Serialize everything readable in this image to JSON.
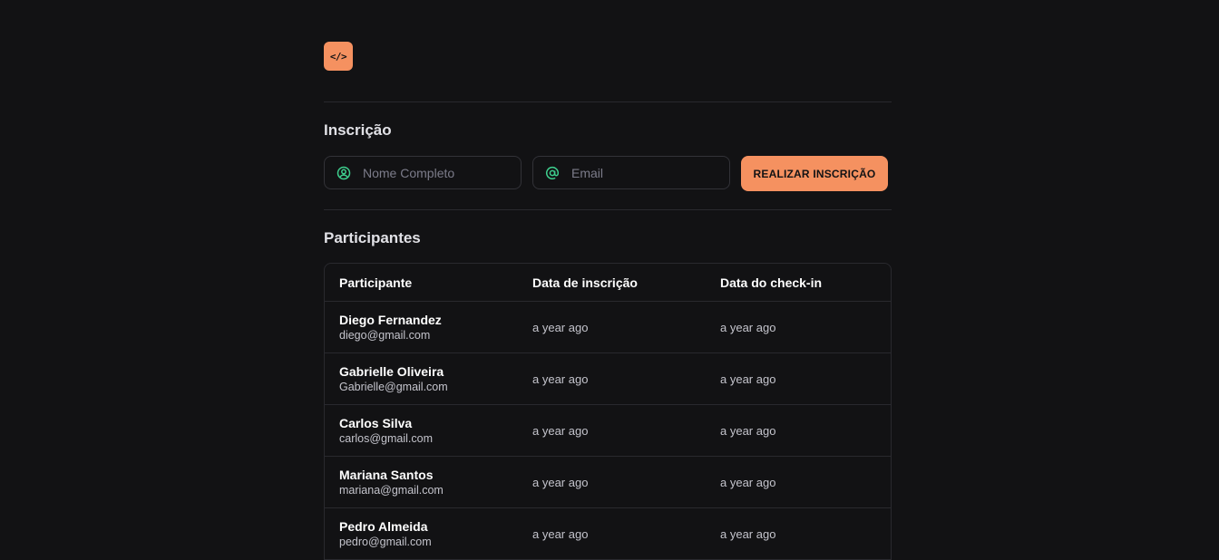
{
  "logo": {
    "glyph": "</>",
    "color": "#f59160"
  },
  "sections": {
    "signup_title": "Inscrição",
    "participants_title": "Participantes"
  },
  "form": {
    "name_placeholder": "Nome Completo",
    "name_value": "",
    "name_icon": "user-circle-icon",
    "email_placeholder": "Email",
    "email_value": "",
    "email_icon": "at-sign-icon",
    "submit_label": "REALIZAR INSCRIÇÃO",
    "icon_color": "#3ecf8e"
  },
  "table": {
    "headers": [
      "Participante",
      "Data de inscrição",
      "Data do check-in"
    ],
    "rows": [
      {
        "name": "Diego Fernandez",
        "email": "diego@gmail.com",
        "subscribed": "a year ago",
        "checkin": "a year ago"
      },
      {
        "name": "Gabrielle Oliveira",
        "email": "Gabrielle@gmail.com",
        "subscribed": "a year ago",
        "checkin": "a year ago"
      },
      {
        "name": "Carlos Silva",
        "email": "carlos@gmail.com",
        "subscribed": "a year ago",
        "checkin": "a year ago"
      },
      {
        "name": "Mariana Santos",
        "email": "mariana@gmail.com",
        "subscribed": "a year ago",
        "checkin": "a year ago"
      },
      {
        "name": "Pedro Almeida",
        "email": "pedro@gmail.com",
        "subscribed": "a year ago",
        "checkin": "a year ago"
      }
    ]
  }
}
